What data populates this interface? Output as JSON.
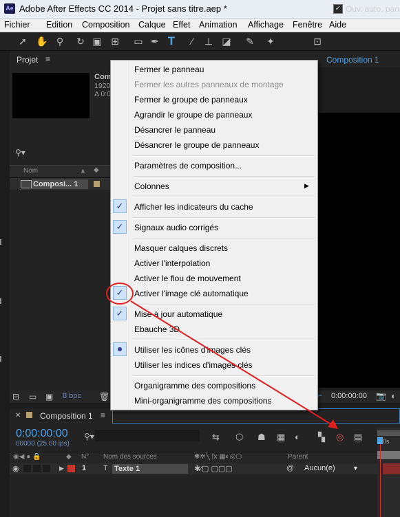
{
  "window": {
    "title": "Adobe After Effects CC 2014 - Projet sans titre.aep *",
    "app_icon_text": "Ae"
  },
  "menubar": [
    "Fichier",
    "Edition",
    "Composition",
    "Calque",
    "Effet",
    "Animation",
    "Affichage",
    "Fenêtre",
    "Aide"
  ],
  "toolbar": {
    "tools": [
      "selection-tool",
      "hand-tool",
      "zoom-tool",
      "rotate-tool",
      "camera-tool",
      "pan-behind-tool",
      "rectangle-tool",
      "pen-tool",
      "type-tool",
      "brush-tool",
      "clone-stamp-tool",
      "eraser-tool",
      "roto-brush-tool",
      "puppet-pin-tool"
    ],
    "auto_open_label": "Ouv. auto. panneau"
  },
  "project_panel": {
    "tab": "Projet",
    "meta_name": "Com",
    "meta_res": "1920",
    "meta_dur": "Δ 0:0",
    "col_name": "Nom",
    "item": {
      "name": "Composi... 1",
      "num": "1"
    },
    "footer_bpc": "8 bpc"
  },
  "comp_panel": {
    "tab": "Composition 1",
    "viewer_time": "0:00:00:00"
  },
  "context_menu": {
    "items": [
      {
        "label": "Fermer le panneau",
        "enabled": true
      },
      {
        "label": "Fermer les autres panneaux de montage",
        "enabled": false
      },
      {
        "label": "Fermer le groupe de panneaux",
        "enabled": true
      },
      {
        "label": "Agrandir le groupe de panneaux",
        "enabled": true
      },
      {
        "label": "Désancrer le panneau",
        "enabled": true
      },
      {
        "label": "Désancrer le groupe de panneaux",
        "enabled": true
      },
      {
        "label": "Paramètres de composition...",
        "enabled": true
      },
      {
        "label": "Colonnes",
        "enabled": true,
        "submenu": true
      },
      {
        "label": "Afficher les indicateurs du cache",
        "checked": true
      },
      {
        "label": "Signaux audio corrigés",
        "checked": true
      },
      {
        "label": "Masquer calques discrets",
        "enabled": true
      },
      {
        "label": "Activer l'interpolation",
        "enabled": true
      },
      {
        "label": "Activer le flou de mouvement",
        "enabled": true
      },
      {
        "label": "Activer l'image clé automatique",
        "checked": true
      },
      {
        "label": "Mise à jour automatique",
        "checked": true
      },
      {
        "label": "Ebauche 3D",
        "enabled": true
      },
      {
        "label": "Utiliser les icônes d'images clés",
        "selected": true
      },
      {
        "label": "Utiliser les indices d'images clés",
        "enabled": true
      },
      {
        "label": "Organigramme des compositions",
        "enabled": true
      },
      {
        "label": "Mini-organigramme des compositions",
        "enabled": true
      }
    ]
  },
  "timeline": {
    "tab": "Composition 1",
    "timecode": "0:00:00:00",
    "fps": "00000 (25.00 ips)",
    "col_num": "N°",
    "col_source": "Nom des sources",
    "col_parent": "Parent",
    "layer": {
      "num": "1",
      "type_icon": "T",
      "name": "Texte 1",
      "parent": "Aucun(e)"
    },
    "ruler_label": "0s"
  },
  "annotation": {
    "color": "#e02020"
  }
}
